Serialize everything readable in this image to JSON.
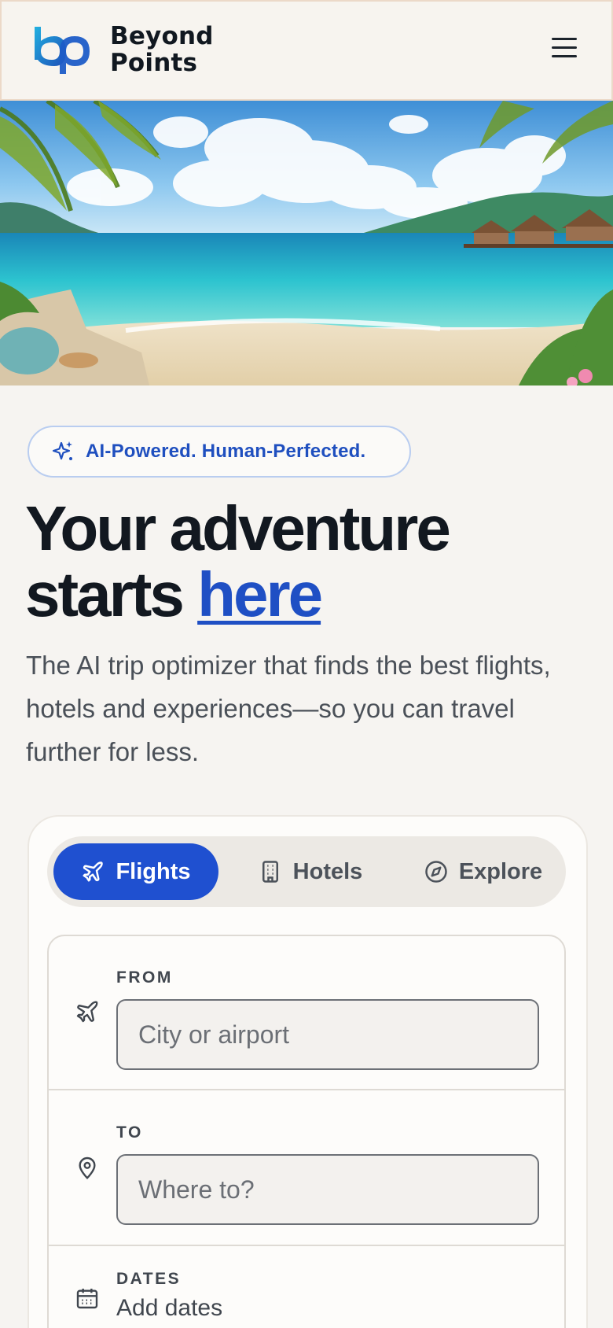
{
  "header": {
    "brand_line1": "Beyond",
    "brand_line2": "Points",
    "menu_icon": "hamburger-menu-icon",
    "logo_colors": [
      "#1d9ad6",
      "#1f4fbf"
    ]
  },
  "hero": {
    "image": "tropical beach with overwater bungalows and palm trees"
  },
  "badge": {
    "icon": "sparkle-icon",
    "label": "AI-Powered. Human-Perfected."
  },
  "headline": {
    "line1": "Your adventure",
    "line2_prefix": "starts ",
    "accent": "here"
  },
  "subtitle": "The AI trip optimizer that finds the best flights, hotels and experiences—so you can travel further for less.",
  "search": {
    "tabs": [
      {
        "label": "Flights",
        "icon": "plane-icon",
        "active": true
      },
      {
        "label": "Hotels",
        "icon": "building-icon",
        "active": false
      },
      {
        "label": "Explore",
        "icon": "compass-icon",
        "active": false
      }
    ],
    "from": {
      "label": "FROM",
      "placeholder": "City or airport",
      "value": ""
    },
    "to": {
      "label": "TO",
      "placeholder": "Where to?",
      "value": ""
    },
    "dates": {
      "label": "DATES",
      "value": "Add dates"
    }
  },
  "colors": {
    "accent": "#1f50d0",
    "background": "#f6f4f1",
    "text": "#121820"
  }
}
